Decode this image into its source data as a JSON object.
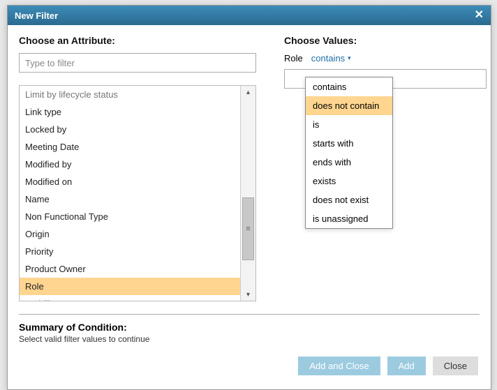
{
  "dialog": {
    "title": "New Filter"
  },
  "left": {
    "heading": "Choose an Attribute:",
    "filter_placeholder": "Type to filter",
    "attributes": [
      "Limit by lifecycle status",
      "Link type",
      "Locked by",
      "Meeting Date",
      "Modified by",
      "Modified on",
      "Name",
      "Non Functional Type",
      "Origin",
      "Priority",
      "Product Owner",
      "Role",
      "Stability"
    ],
    "cut_index": 0,
    "selected_index": 11,
    "scroll_thumb_glyph": "≡"
  },
  "right": {
    "heading": "Choose Values:",
    "attr_label": "Role",
    "operator_selected": "contains",
    "operators": [
      "contains",
      "does not contain",
      "is",
      "starts with",
      "ends with",
      "exists",
      "does not exist",
      "is unassigned"
    ],
    "highlight_index": 1,
    "value_text": ""
  },
  "summary": {
    "heading": "Summary of Condition:",
    "text": "Select valid filter values to continue"
  },
  "buttons": {
    "add_close": "Add and Close",
    "add": "Add",
    "close": "Close"
  }
}
